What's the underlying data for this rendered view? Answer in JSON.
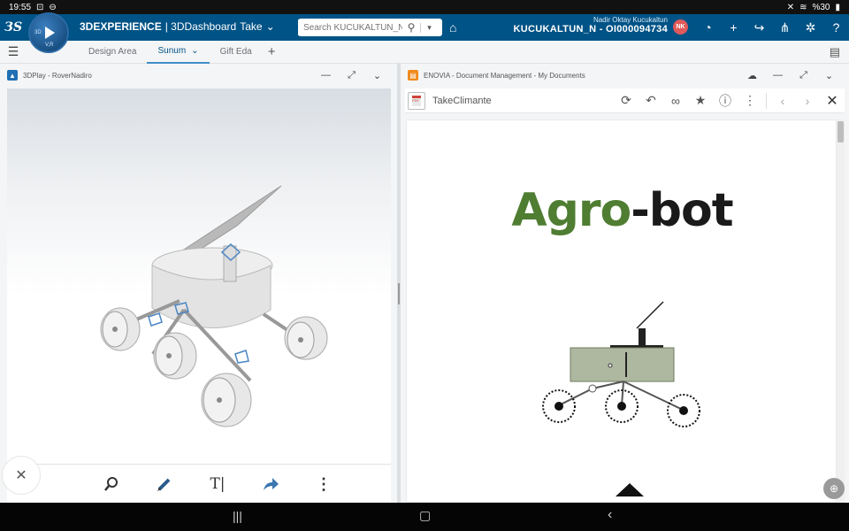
{
  "status_bar": {
    "time": "19:55",
    "battery": "%30"
  },
  "topbar": {
    "brand_bold": "3DEXPERIENCE",
    "brand_app": "| 3DDashboard",
    "dashboard": "Take",
    "search_placeholder": "Search KUCUKALTUN_N",
    "user_name": "Nadir Oktay Kucukaltun",
    "user_id": "KUCUKALTUN_N - OI000094734",
    "avatar_initials": "NK",
    "compass_label": "V,R",
    "compass_3d": "3D"
  },
  "tabs": [
    {
      "label": "Design Area"
    },
    {
      "label": "Sunum"
    },
    {
      "label": "Gift Eda"
    }
  ],
  "left_panel": {
    "title": "3DPlay - RoverNadiro",
    "accent": "#1e6fb4"
  },
  "right_panel": {
    "title": "ENOVIA - Document Management - My Documents",
    "accent": "#f08a1c",
    "document_name": "TakeClimante",
    "document_heading_part1": "Agro",
    "document_heading_part2": "-bot",
    "heading_green": "#4f7d32"
  },
  "tools": {
    "tool_icons": [
      "magnify-icon",
      "pencil-icon",
      "text-icon",
      "share-arrow-icon",
      "more-vertical-icon"
    ]
  }
}
